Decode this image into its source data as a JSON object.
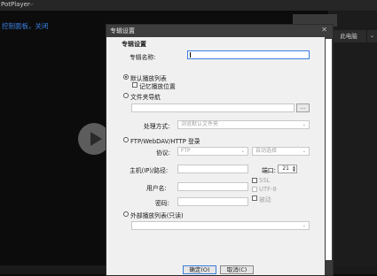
{
  "app": {
    "title": "PotPlayer",
    "subtitle": "控制面板，关闭"
  },
  "right_panel": {
    "button": "此电脑"
  },
  "dialog": {
    "title": "专辑设置",
    "section_title": "专辑设置",
    "name_label": "专辑名称:",
    "name_value": "",
    "default_playlist_label": "默认播放列表",
    "remember_position_label": "记忆播放位置",
    "folder_nav_label": "文件夹导航",
    "browse_button": "...",
    "process_label": "处理方式:",
    "process_value": "浏览默认文件夹",
    "ftp_label": "FTP/WebDAV/HTTP 登录",
    "protocol_label": "协议:",
    "protocol_value": "FTP",
    "encoding_value": "自动选择",
    "host_label": "主机(IP)/路径:",
    "port_label": "端口:",
    "port_value": "21",
    "ssl_label": "SSL",
    "user_label": "用户名:",
    "utf8_label": "UTF-8",
    "passive_label": "被动",
    "password_label": "密码:",
    "external_playlist_label": "外部播放列表(只读)",
    "ok_button": "确定(O)",
    "cancel_button": "取消(C)"
  },
  "colors": {
    "accent": "#3a7fe0",
    "dialog_bg": "#f0f0f0",
    "titlebar": "#3d3d3d"
  }
}
